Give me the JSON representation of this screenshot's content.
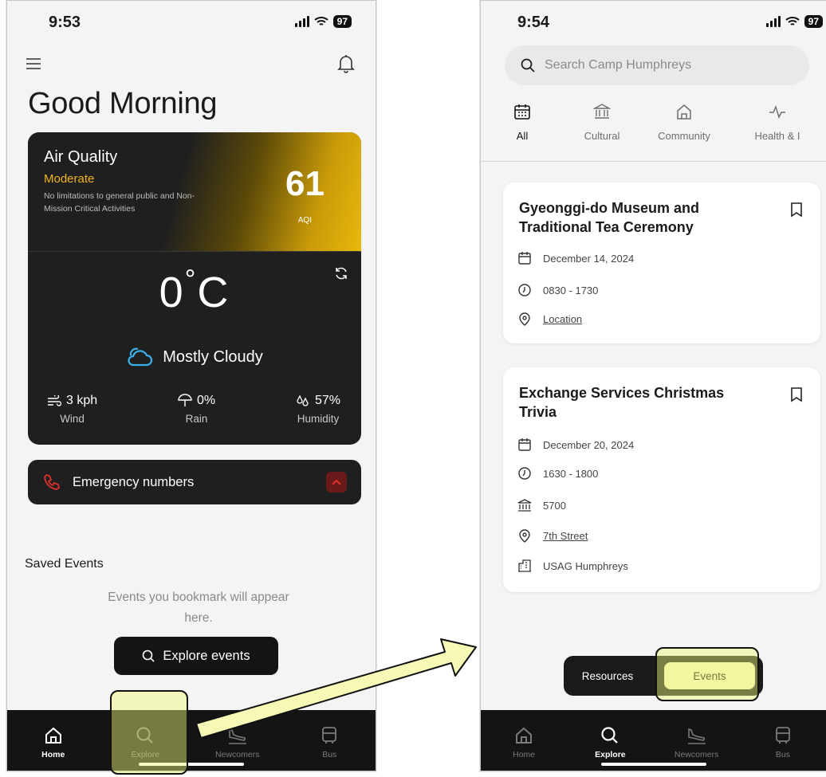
{
  "left_screen": {
    "status_time": "9:53",
    "battery": "97",
    "greeting": "Good Morning",
    "air_quality": {
      "title": "Air Quality",
      "status": "Moderate",
      "description": "No limitations to general public and Non-Mission Critical Activities",
      "value": "61",
      "unit": "AQI"
    },
    "weather": {
      "temperature": "0",
      "unit": "C",
      "condition": "Mostly Cloudy",
      "wind_value": "3 kph",
      "wind_label": "Wind",
      "rain_value": "0%",
      "rain_label": "Rain",
      "humidity_value": "57%",
      "humidity_label": "Humidity"
    },
    "emergency_label": "Emergency numbers",
    "saved_events_heading": "Saved Events",
    "saved_events_empty": "Events you bookmark will appear here.",
    "explore_button": "Explore events",
    "tabs": [
      "Home",
      "Explore",
      "Newcomers",
      "Bus"
    ]
  },
  "right_screen": {
    "status_time": "9:54",
    "battery": "97",
    "search_placeholder": "Search Camp Humphreys",
    "categories": [
      "All",
      "Cultural",
      "Community",
      "Health & I"
    ],
    "events": [
      {
        "title": "Gyeonggi-do Museum and Traditional Tea Ceremony",
        "date": "December 14, 2024",
        "time": "0830 - 1730",
        "location": "Location"
      },
      {
        "title": "Exchange Services Christmas Trivia",
        "date": "December 20, 2024",
        "time": "1630 - 1800",
        "building": "5700",
        "location": "7th Street",
        "organizer": "USAG Humphreys"
      }
    ],
    "segment": [
      "Resources",
      "Events"
    ],
    "tabs": [
      "Home",
      "Explore",
      "Newcomers",
      "Bus"
    ]
  },
  "colors": {
    "aqi_moderate": "#f2b51b",
    "dark_card": "#1f1f1f",
    "highlight": "#f0f678",
    "emergency_red": "#e0312c",
    "cloud_blue": "#3ab0ea"
  }
}
